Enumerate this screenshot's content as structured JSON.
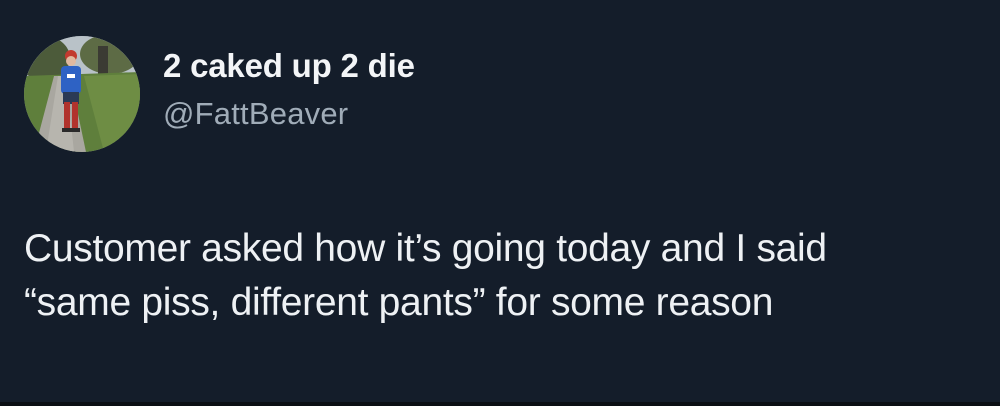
{
  "tweet": {
    "author": {
      "display_name": "2 caked up 2 die",
      "handle": "@FattBeaver",
      "avatar_icon": "profile-photo"
    },
    "text_lines": [
      "Customer asked how it’s going today and I said",
      "“same piss, different pants” for some reason"
    ]
  },
  "colors": {
    "background": "#141d2a",
    "name": "#f3f5f7",
    "handle": "#a0acb8",
    "text": "#eef1f4"
  }
}
